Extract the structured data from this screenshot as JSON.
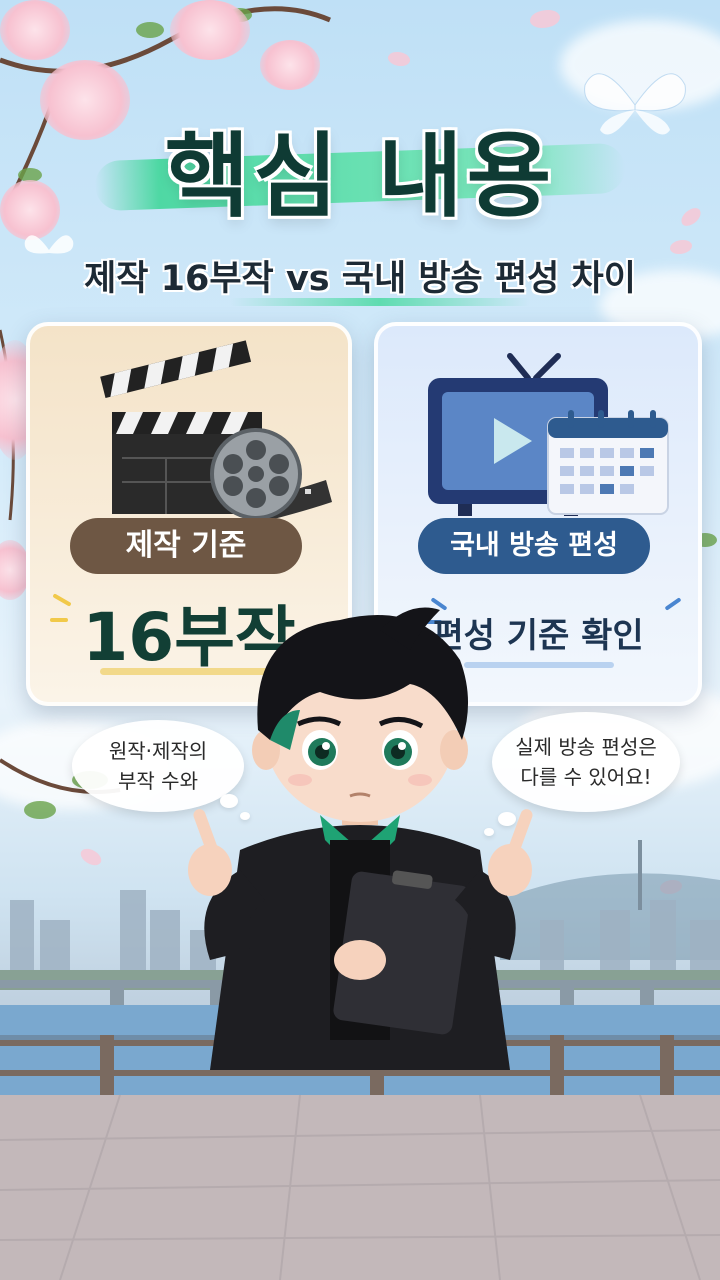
{
  "title": "핵심 내용",
  "subtitle": "제작 16부작 vs 국내 방송 편성 차이",
  "left_card": {
    "pill": "제작 기준",
    "value": "16부작",
    "icon": "clapperboard-film-reel-icon"
  },
  "right_card": {
    "pill": "국내 방송 편성",
    "value": "편성 기준 확인",
    "icon": "tv-calendar-icon"
  },
  "bubbles": {
    "left_line1": "원작·제작의",
    "left_line2": "부작 수와",
    "right_line1": "실제 방송 편성은",
    "right_line2": "다를 수 있어요!"
  },
  "colors": {
    "title": "#0f3b34",
    "brush": "#4fd8a4",
    "pill_left": "#6e5744",
    "pill_right": "#2e5b8f",
    "value_left": "#123f35",
    "value_right": "#1d3552"
  }
}
